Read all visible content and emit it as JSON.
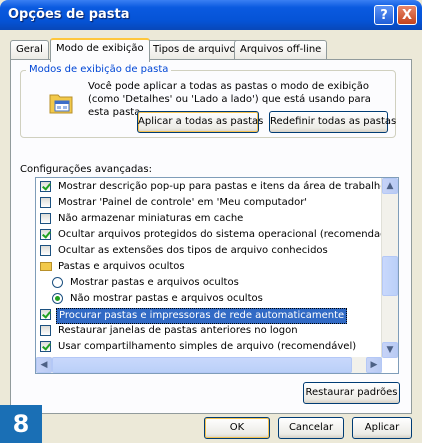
{
  "window": {
    "title": "Opções de pasta"
  },
  "titlebar": {
    "help": "?",
    "close": "X"
  },
  "tabs": [
    {
      "label": "Geral"
    },
    {
      "label": "Modo de exibição"
    },
    {
      "label": "Tipos de arquivo"
    },
    {
      "label": "Arquivos off-line"
    }
  ],
  "group": {
    "title": "Modos de exibição de pasta",
    "description": "Você pode aplicar a todas as pastas o modo de exibição (como 'Detalhes' ou 'Lado a lado') que está usando para esta pasta.",
    "apply_all": "Aplicar a todas as pastas",
    "reset_all": "Redefinir todas as pastas",
    "icon": "folder-window-icon"
  },
  "advanced": {
    "label": "Configurações avançadas:",
    "items": [
      {
        "type": "check",
        "checked": true,
        "label": "Mostrar descrição pop-up para pastas e itens da área de trabalho"
      },
      {
        "type": "check",
        "checked": false,
        "label": "Mostrar 'Painel de controle' em 'Meu computador'"
      },
      {
        "type": "check",
        "checked": false,
        "label": "Não armazenar miniaturas em cache"
      },
      {
        "type": "check",
        "checked": true,
        "label": "Ocultar arquivos protegidos do sistema operacional (recomendado)"
      },
      {
        "type": "check",
        "checked": false,
        "label": "Ocultar as extensões dos tipos de arquivo conhecidos"
      },
      {
        "type": "folder",
        "label": "Pastas e arquivos ocultos"
      },
      {
        "type": "radio",
        "checked": false,
        "label": "Mostrar pastas e arquivos ocultos"
      },
      {
        "type": "radio",
        "checked": true,
        "label": "Não mostrar pastas e arquivos ocultos"
      },
      {
        "type": "check",
        "checked": true,
        "highlight": true,
        "label": "Procurar pastas e impressoras de rede automaticamente"
      },
      {
        "type": "check",
        "checked": false,
        "label": "Restaurar janelas de pastas anteriores no logon"
      },
      {
        "type": "check",
        "checked": true,
        "label": "Usar compartilhamento simples de arquivo (recomendável)"
      }
    ],
    "restore_defaults": "Restaurar padrões"
  },
  "footer": {
    "ok": "OK",
    "cancel": "Cancelar",
    "apply": "Aplicar"
  },
  "badge": "8",
  "colors": {
    "titlebar": "#0553d6",
    "group_title": "#0046d5",
    "selection": "#316ac5",
    "badge": "#1a6fb5"
  }
}
